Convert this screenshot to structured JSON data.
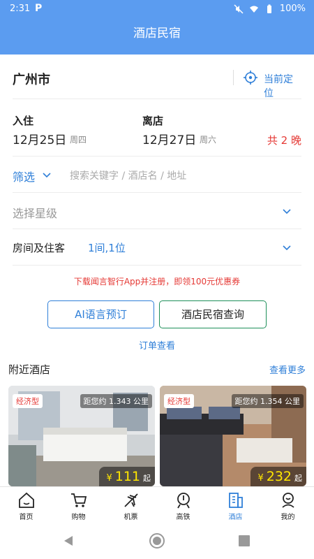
{
  "status": {
    "time": "2:31",
    "app_icon": "P",
    "battery": "100%"
  },
  "header": {
    "title": "酒店民宿"
  },
  "location": {
    "city": "广州市",
    "current_location_label": "当前定位"
  },
  "dates": {
    "checkin_label": "入住",
    "checkin_date": "12月25日",
    "checkin_weekday": "周四",
    "checkout_label": "离店",
    "checkout_date": "12月27日",
    "checkout_weekday": "周六",
    "nights": "共 2 晚"
  },
  "filter": {
    "label": "筛选",
    "search_placeholder": "搜索关键字 / 酒店名 / 地址"
  },
  "star": {
    "label": "选择星级"
  },
  "guests": {
    "label": "房间及住客",
    "value": "1间,1位"
  },
  "promo": {
    "text": "下载闻言智行App并注册，即领100元优惠券"
  },
  "buttons": {
    "ai_booking": "AI语言预订",
    "hotel_search": "酒店民宿查询"
  },
  "orders_link": "订单查看",
  "nearby": {
    "title": "附近酒店",
    "see_more": "查看更多",
    "hotels": [
      {
        "tag": "经济型",
        "distance": "距您约 1.343 公里",
        "currency": "¥",
        "price": "111",
        "suffix": "起"
      },
      {
        "tag": "经济型",
        "distance": "距您约 1.354 公里",
        "currency": "¥",
        "price": "232",
        "suffix": "起"
      }
    ]
  },
  "tabbar": {
    "items": [
      {
        "label": "首页",
        "icon": "home-icon"
      },
      {
        "label": "购物",
        "icon": "cart-icon"
      },
      {
        "label": "机票",
        "icon": "plane-icon"
      },
      {
        "label": "高铁",
        "icon": "train-icon"
      },
      {
        "label": "酒店",
        "icon": "hotel-icon",
        "active": true
      },
      {
        "label": "我的",
        "icon": "profile-icon"
      }
    ]
  },
  "colors": {
    "header_bg": "#5b9cf0",
    "accent": "#2f7fd8",
    "alert": "#e53935",
    "price": "#ffe600"
  }
}
